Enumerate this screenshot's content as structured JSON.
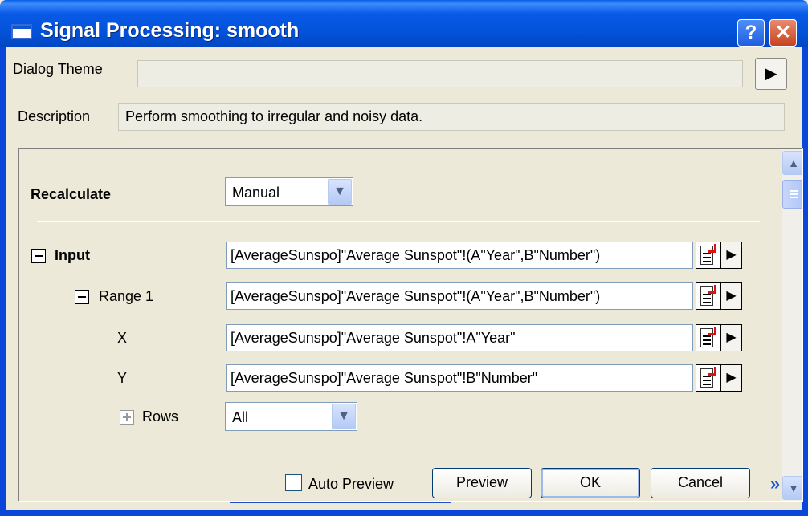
{
  "window": {
    "title": "Signal Processing: smooth",
    "help": "?",
    "close": "✕"
  },
  "theme": {
    "label": "Dialog Theme",
    "value": "",
    "arrow": "▶"
  },
  "description": {
    "label": "Description",
    "value": "Perform smoothing to irregular and noisy data."
  },
  "panel": {
    "recalculate": {
      "label": "Recalculate",
      "value": "Manual"
    },
    "input": {
      "label": "Input",
      "value": "[AverageSunspo]\"Average Sunspot\"!(A\"Year\",B\"Number\")"
    },
    "range1": {
      "label": "Range 1",
      "value": "[AverageSunspo]\"Average Sunspot\"!(A\"Year\",B\"Number\")"
    },
    "x": {
      "label": "X",
      "value": "[AverageSunspo]\"Average Sunspot\"!A\"Year\""
    },
    "y": {
      "label": "Y",
      "value": "[AverageSunspo]\"Average Sunspot\"!B\"Number\""
    },
    "rows": {
      "label": "Rows",
      "value": "All"
    },
    "dropdown_glyph": "▼",
    "arrow_glyph": "▶"
  },
  "scrollbar": {
    "up": "▲",
    "down": "▼"
  },
  "buttons": {
    "auto_preview": "Auto Preview",
    "auto_preview_checked": false,
    "preview": "Preview",
    "ok": "OK",
    "cancel": "Cancel",
    "expand": "»"
  }
}
